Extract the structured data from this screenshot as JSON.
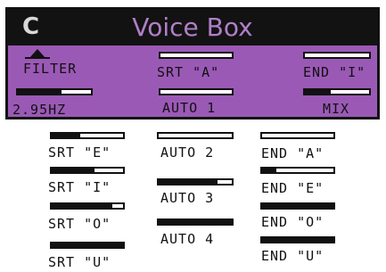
{
  "header": {
    "badge": "C",
    "title": "Voice Box"
  },
  "filter": {
    "label": "FILTER",
    "value": "2.95HZ",
    "level": 0.6
  },
  "top_row": [
    {
      "label": "SRT \"A\"",
      "level": 0.0
    },
    {
      "label": "END \"I\"",
      "level": 0.0
    }
  ],
  "panel_bottom": [
    {
      "label": "AUTO 1",
      "level": 0.0
    },
    {
      "label": "MIX",
      "level": 0.4
    }
  ],
  "srt_column": [
    {
      "label": "SRT \"E\"",
      "level": 0.4
    },
    {
      "label": "SRT \"I\"",
      "level": 0.6
    },
    {
      "label": "SRT \"O\"",
      "level": 0.85
    },
    {
      "label": "SRT \"U\"",
      "level": 1.0
    }
  ],
  "auto_column": [
    {
      "label": "AUTO 2",
      "level": 0.0
    },
    {
      "label": "AUTO 3",
      "level": 0.8
    },
    {
      "label": "AUTO 4",
      "level": 1.0
    }
  ],
  "end_column": [
    {
      "label": "END \"A\"",
      "level": 0.0
    },
    {
      "label": "END \"E\"",
      "level": 0.2
    },
    {
      "label": "END \"O\"",
      "level": 1.0
    },
    {
      "label": "END \"U\"",
      "level": 1.0
    }
  ]
}
